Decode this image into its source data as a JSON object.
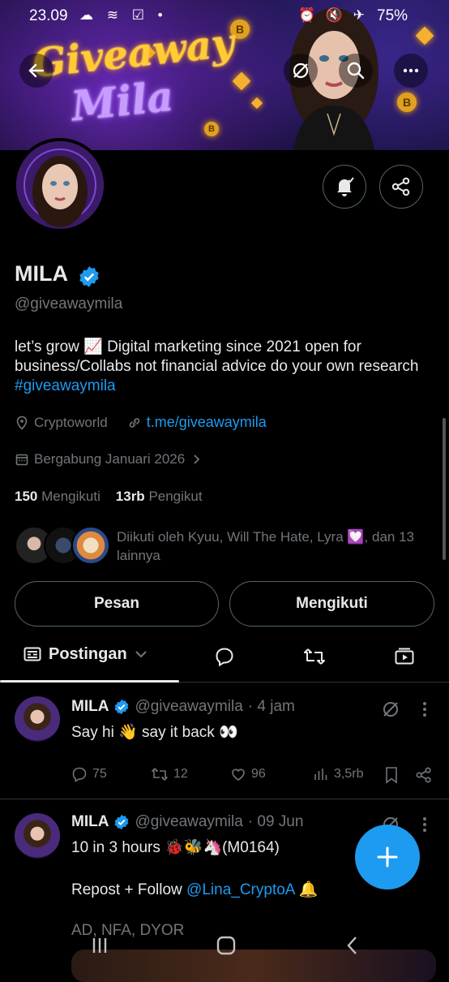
{
  "status_bar": {
    "time": "23.09",
    "battery": "75%"
  },
  "banner": {
    "line1": "Giveaway",
    "line2": "Mila",
    "coin_symbol": "B"
  },
  "profile": {
    "name": "MILA",
    "handle": "@giveawaymila",
    "bio_text": "let’s grow 📈 Digital marketing since 2021 open for business/Collabs not financial advice do your own research ",
    "bio_hashtag": "#giveawaymila",
    "location": "Cryptoworld",
    "link": "t.me/giveawaymila",
    "joined": "Bergabung Januari 2026",
    "following_count": "150",
    "following_label": "Mengikuti",
    "followers_count": "13rb",
    "followers_label": "Pengikut",
    "followed_by": "Diikuti oleh Kyuu, Will The Hate, Lyra 💟, dan 13 lainnya"
  },
  "actions": {
    "message": "Pesan",
    "following": "Mengikuti"
  },
  "tabs": {
    "active": "Postingan"
  },
  "tweets": [
    {
      "name": "MILA",
      "handle": "@giveawaymila",
      "time": "· 4 jam",
      "text": "Say hi 👋 say it back 👀",
      "replies": "75",
      "reposts": "12",
      "likes": "96",
      "views": "3,5rb"
    },
    {
      "name": "MILA",
      "handle": "@giveawaymila",
      "time": "· 09 Jun",
      "line1": "10 in 3 hours 🐞🐝🦄(M0164)",
      "line2_prefix": "Repost + Follow ",
      "line2_mention": "@Lina_CryptoA",
      "line2_suffix": " 🔔",
      "line3": "AD, NFA, DYOR"
    }
  ],
  "colors": {
    "accent": "#1d9bf0",
    "background": "#000000",
    "text_primary": "#e7e9ea",
    "text_secondary": "#71767b",
    "border": "#2f3336"
  }
}
